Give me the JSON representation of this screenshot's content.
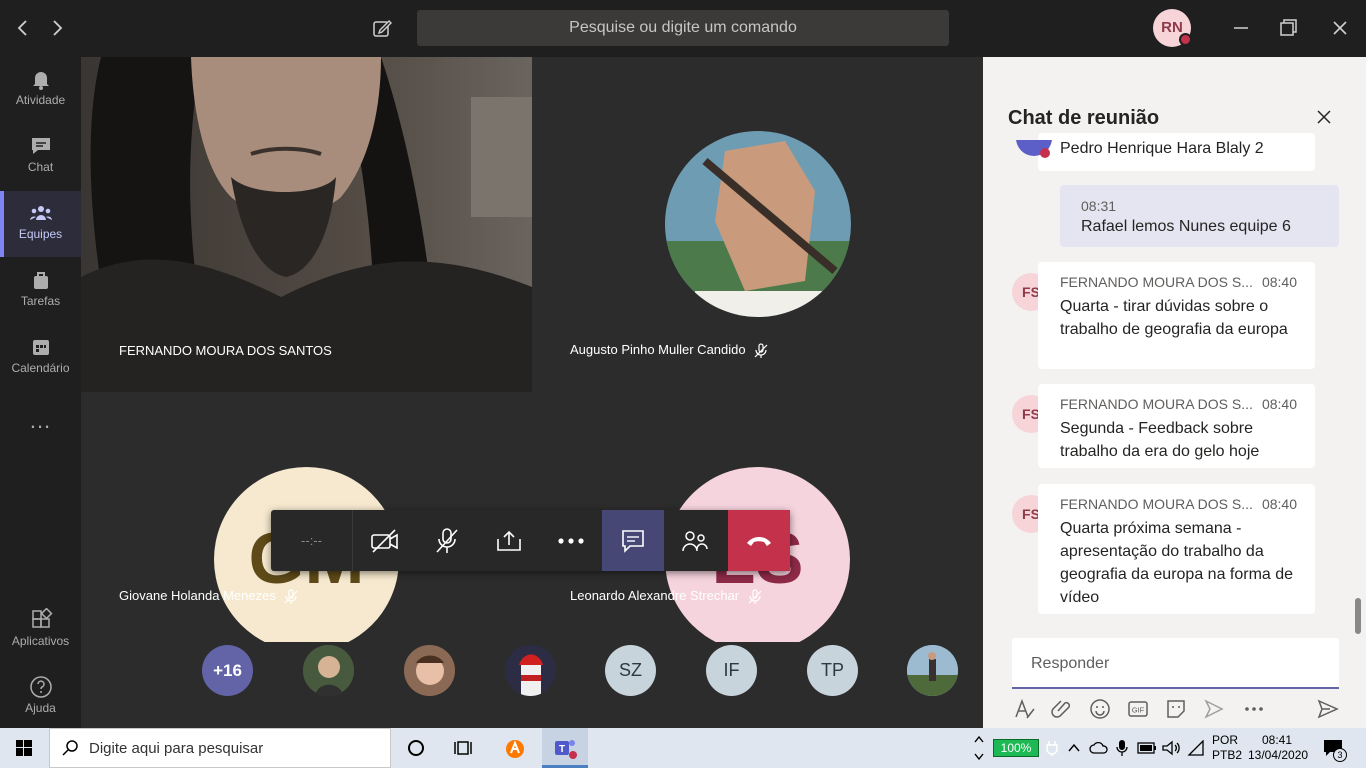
{
  "titlebar": {
    "search_placeholder": "Pesquise ou digite um comando",
    "user_initials": "RN"
  },
  "rail": {
    "items": [
      {
        "label": "Atividade",
        "icon": "bell-icon"
      },
      {
        "label": "Chat",
        "icon": "chat-icon"
      },
      {
        "label": "Equipes",
        "icon": "teams-icon",
        "active": true
      },
      {
        "label": "Tarefas",
        "icon": "bag-icon"
      },
      {
        "label": "Calendário",
        "icon": "calendar-icon"
      },
      {
        "label": "...",
        "icon": "more-icon"
      }
    ],
    "apps_label": "Aplicativos",
    "help_label": "Ajuda"
  },
  "stage": {
    "tiles": [
      {
        "name": "FERNANDO MOURA DOS SANTOS"
      },
      {
        "name": "Augusto Pinho Muller Candido"
      },
      {
        "name": "Giovane Holanda Menezes",
        "initials": "GM"
      },
      {
        "name": "Leonardo Alexandre Strechar",
        "initials": "LS"
      }
    ],
    "timer": "--:--",
    "overflow_count": "+16",
    "participants": [
      "SZ",
      "IF",
      "TP"
    ]
  },
  "chat": {
    "title": "Chat de reunião",
    "partial_msg": "Pedro Henrique Hara Blaly 2",
    "my_msg": {
      "time": "08:31",
      "text": "Rafael lemos Nunes equipe 6"
    },
    "messages": [
      {
        "initials": "FS",
        "author": "FERNANDO MOURA DOS S...",
        "time": "08:40",
        "text": "Quarta - tirar dúvidas sobre o trabalho de geografia da europa"
      },
      {
        "initials": "FS",
        "author": "FERNANDO MOURA DOS S...",
        "time": "08:40",
        "text": "Segunda - Feedback sobre trabalho da era do gelo hoje"
      },
      {
        "initials": "FS",
        "author": "FERNANDO MOURA DOS S...",
        "time": "08:40",
        "text": "Quarta próxima semana - apresentação do trabalho da geografia da europa na forma de vídeo"
      }
    ],
    "reply_placeholder": "Responder"
  },
  "taskbar": {
    "search_placeholder": "Digite aqui para pesquisar",
    "battery": "100%",
    "lang1": "POR",
    "lang2": "PTB2",
    "time": "08:41",
    "date": "13/04/2020",
    "notifications": "3"
  },
  "colors": {
    "accent": "#6264a7",
    "end_call": "#c4314b",
    "gm_bg": "#f6e9cf",
    "ls_bg": "#f6d4de"
  }
}
